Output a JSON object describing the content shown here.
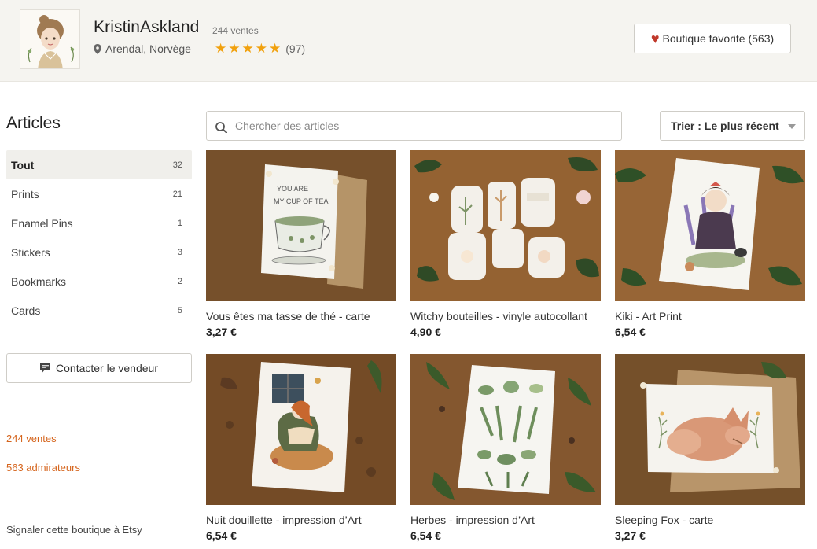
{
  "shop": {
    "name": "KristinAskland",
    "sales_small": "244 ventes",
    "location": "Arendal, Norvège",
    "rating_count": "(97)",
    "stars": 5,
    "favorite_label": "Boutique favorite (563)"
  },
  "sidebar": {
    "title": "Articles",
    "categories": [
      {
        "label": "Tout",
        "count": "32"
      },
      {
        "label": "Prints",
        "count": "21"
      },
      {
        "label": "Enamel Pins",
        "count": "1"
      },
      {
        "label": "Stickers",
        "count": "3"
      },
      {
        "label": "Bookmarks",
        "count": "2"
      },
      {
        "label": "Cards",
        "count": "5"
      }
    ],
    "contact_label": "Contacter le vendeur",
    "sales_link": "244 ventes",
    "admirers_link": "563 admirateurs",
    "report_link": "Signaler cette boutique à Etsy"
  },
  "search": {
    "placeholder": "Chercher des articles"
  },
  "sort": {
    "label": "Trier : Le plus récent"
  },
  "listings": [
    {
      "title": "Vous êtes ma tasse de thé - carte",
      "price": "3,27 €"
    },
    {
      "title": "Witchy bouteilles - vinyle autocollant",
      "price": "4,90 €"
    },
    {
      "title": "Kiki - Art Print",
      "price": "6,54 €"
    },
    {
      "title": "Nuit douillette - impression d’Art",
      "price": "6,54 €"
    },
    {
      "title": "Herbes - impression d’Art",
      "price": "6,54 €"
    },
    {
      "title": "Sleeping Fox - carte",
      "price": "3,27 €"
    }
  ],
  "icons": {
    "location": "map-pin-icon",
    "favorite": "heart-icon",
    "contact": "message-icon",
    "search": "search-icon",
    "sort": "caret-down-icon"
  },
  "colors": {
    "accent": "#d5641c",
    "star": "#f1a10e",
    "heart": "#c0392b",
    "header_bg": "#f5f4f0"
  }
}
